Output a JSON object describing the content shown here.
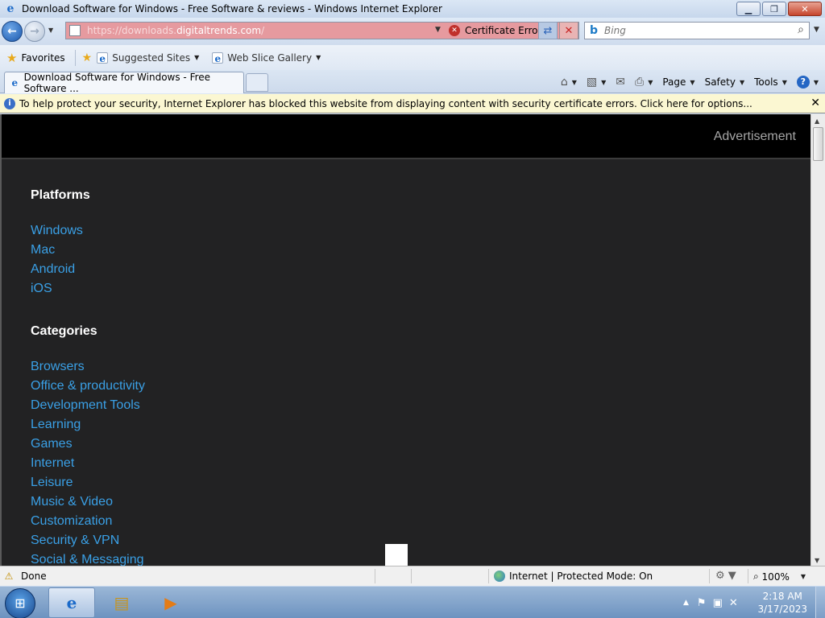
{
  "window": {
    "title": "Download Software for Windows - Free Software & reviews - Windows Internet Explorer",
    "minimize": "▁",
    "restore": "❐",
    "close": "✕"
  },
  "address": {
    "url_prefix": "https://downloads.",
    "url_domain": "digitaltrends.com",
    "url_suffix": "/",
    "certificate_error": "Certificate Error",
    "bg_color": "#e69a9f"
  },
  "search": {
    "placeholder": "Bing"
  },
  "favorites": {
    "favorites_label": "Favorites",
    "suggested_sites": "Suggested Sites",
    "web_slice_gallery": "Web Slice Gallery"
  },
  "tab": {
    "title": "Download Software for Windows - Free Software ..."
  },
  "command_bar": {
    "page": "Page",
    "safety": "Safety",
    "tools": "Tools"
  },
  "infobar": {
    "message": "To help protect your security, Internet Explorer has blocked this website from displaying content with security certificate errors. Click here for options..."
  },
  "page": {
    "advertisement": "Advertisement",
    "link_color": "#3aa0e6",
    "platforms": {
      "title": "Platforms",
      "items": [
        "Windows",
        "Mac",
        "Android",
        "iOS"
      ]
    },
    "categories": {
      "title": "Categories",
      "items": [
        "Browsers",
        "Office & productivity",
        "Development Tools",
        "Learning",
        "Games",
        "Internet",
        "Leisure",
        "Music & Video",
        "Customization",
        "Security & VPN",
        "Social & Messaging"
      ]
    }
  },
  "status": {
    "text": "Done",
    "zone": "Internet | Protected Mode: On",
    "zoom": "100%"
  },
  "taskbar": {
    "time": "2:18 AM",
    "date": "3/17/2023"
  }
}
